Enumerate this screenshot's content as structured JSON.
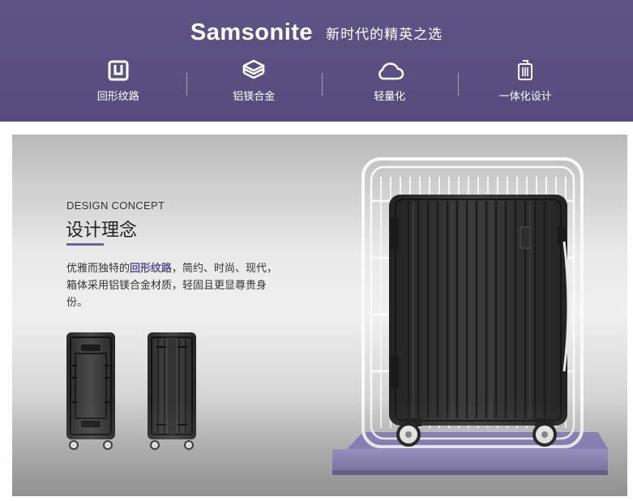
{
  "header": {
    "brand": "Samsonite",
    "slogan": "新时代的精英之选",
    "features": [
      {
        "icon": "ribbed-pattern-icon",
        "label": "回形纹路"
      },
      {
        "icon": "cube-icon",
        "label": "铝镁合金"
      },
      {
        "icon": "cloud-icon",
        "label": "轻量化"
      },
      {
        "icon": "luggage-icon",
        "label": "一体化设计"
      }
    ]
  },
  "concept": {
    "title_en": "DESIGN CONCEPT",
    "title_zh": "设计理念",
    "desc_before": "优雅而独特的",
    "desc_highlight": "回形纹路",
    "desc_after": "，简约、时尚、现代，箱体采用铝镁合金材质，轻固且更显尊贵身份。"
  },
  "colors": {
    "header_bg": "#5a5180",
    "accent": "#6d6496",
    "pedestal": "#8b80bd"
  }
}
